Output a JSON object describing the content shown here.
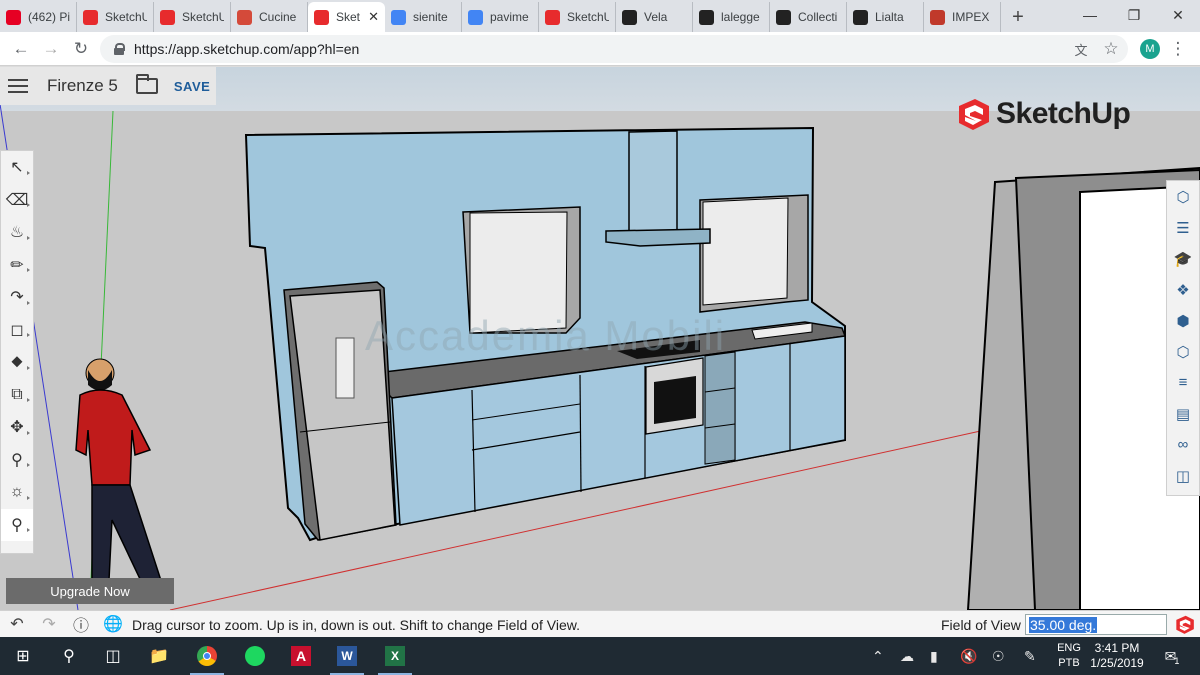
{
  "browser": {
    "tabs": [
      {
        "label": "(462) Pi",
        "icon": "pinterest-icon",
        "color": "#e60023"
      },
      {
        "label": "SketchU",
        "icon": "sketchup-icon",
        "color": "#e72b2d"
      },
      {
        "label": "SketchU",
        "icon": "sketchup-icon",
        "color": "#e72b2d"
      },
      {
        "label": "Cucine",
        "icon": "grid-site-icon",
        "color": "#d44a3a"
      },
      {
        "label": "Sket",
        "icon": "sketchup-icon",
        "color": "#e72b2d",
        "active": true
      },
      {
        "label": "sienite",
        "icon": "google-icon",
        "color": "#4285f4"
      },
      {
        "label": "pavime",
        "icon": "google-icon",
        "color": "#4285f4"
      },
      {
        "label": "SketchU",
        "icon": "sketchup-icon",
        "color": "#e72b2d"
      },
      {
        "label": "Vela",
        "icon": "m-site-icon",
        "color": "#222222"
      },
      {
        "label": "lalegge",
        "icon": "a-site-icon",
        "color": "#222222"
      },
      {
        "label": "Collecti",
        "icon": "m-circle-icon",
        "color": "#222222"
      },
      {
        "label": "Lialta",
        "icon": "z-site-icon",
        "color": "#222222"
      },
      {
        "label": "IMPEX",
        "icon": "impex-icon",
        "color": "#c0392b"
      }
    ],
    "url": "https://app.sketchup.com/app?hl=en",
    "profile_initial": "M"
  },
  "app": {
    "model_name": "Firenze 5",
    "save_label": "SAVE",
    "logo_text": "SketchUp",
    "upgrade_label": "Upgrade Now",
    "watermark": "Accademia Mobili",
    "brand_red": "#e72b2d",
    "left_tools": [
      "select-tool-icon",
      "eraser-tool-icon",
      "paint-bucket-tool-icon",
      "line-tool-icon",
      "arc-tool-icon",
      "rectangle-tool-icon",
      "push-pull-tool-icon",
      "offset-tool-icon",
      "move-tool-icon",
      "tape-measure-tool-icon",
      "orbit-tool-icon",
      "zoom-tool-icon"
    ],
    "right_tools": [
      "entity-info-icon",
      "outliner-icon",
      "instructor-icon",
      "components-icon",
      "materials-icon",
      "styles-icon",
      "layers-icon",
      "scenes-icon",
      "display-icon",
      "3d-warehouse-icon"
    ]
  },
  "status": {
    "message": "Drag cursor to zoom. Up is in, down is out. Shift to change Field of View.",
    "fov_label": "Field of View",
    "fov_value": "35.00 deg."
  },
  "taskbar": {
    "lang": "ENG",
    "layout": "PTB",
    "time": "3:41 PM",
    "date": "1/25/2019",
    "notifications": "1"
  }
}
